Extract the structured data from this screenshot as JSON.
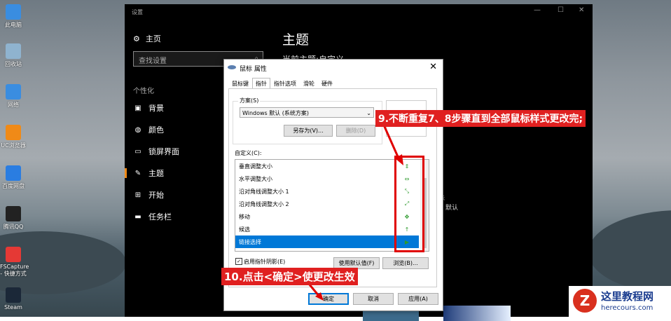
{
  "desktop": {
    "icons": [
      {
        "label": "此电脑",
        "color": "#3a8de0"
      },
      {
        "label": "回收站",
        "color": "#8fb3cf"
      },
      {
        "label": "网络",
        "color": "#3a8de0"
      },
      {
        "label": "UC浏览器",
        "color": "#f08a17"
      },
      {
        "label": "百度网盘",
        "color": "#2a7de1"
      },
      {
        "label": "腾讯QQ",
        "color": "#222222"
      },
      {
        "label": "FSCapture - 快捷方式",
        "color": "#e53935"
      },
      {
        "label": "Steam",
        "color": "#1b2838"
      }
    ]
  },
  "settings": {
    "window_title": "设置",
    "controls": {
      "minimize": "—",
      "maximize": "☐",
      "close": "✕"
    },
    "home": "主页",
    "search_placeholder": "查找设置",
    "group": "个性化",
    "nav": [
      {
        "label": "背景",
        "icon": "image-icon"
      },
      {
        "label": "颜色",
        "icon": "palette-icon"
      },
      {
        "label": "锁屏界面",
        "icon": "lockscreen-icon"
      },
      {
        "label": "主题",
        "icon": "theme-icon",
        "active": true
      },
      {
        "label": "开始",
        "icon": "start-icon"
      },
      {
        "label": "任务栏",
        "icon": "taskbar-icon"
      }
    ],
    "heading": "主题",
    "current_theme": "当前主题:自定义",
    "fragment_1": "标",
    "fragment_2": "默认"
  },
  "dialog": {
    "title": "鼠标 属性",
    "close": "✕",
    "tabs": [
      "鼠标键",
      "指针",
      "指针选项",
      "滑轮",
      "硬件"
    ],
    "selected_tab": "指针",
    "scheme_label": "方案(S)",
    "scheme_value": "Windows 默认 (系统方案)",
    "save_as": "另存为(V)...",
    "delete": "删除(D)",
    "customize_label": "自定义(C):",
    "items": [
      {
        "name": "垂直调整大小",
        "cursor": "⇕"
      },
      {
        "name": "水平调整大小",
        "cursor": "⇔"
      },
      {
        "name": "沿对角线调整大小 1",
        "cursor": "⤡"
      },
      {
        "name": "沿对角线调整大小 2",
        "cursor": "⤢"
      },
      {
        "name": "移动",
        "cursor": "✥"
      },
      {
        "name": "候选",
        "cursor": "↑"
      },
      {
        "name": "链接选择",
        "cursor": "▶",
        "selected": true
      }
    ],
    "shadow_label": "启用指针阴影(E)",
    "shadow_checked": true,
    "use_default": "使用默认值(F)",
    "browse": "浏览(B)...",
    "ok": "确定",
    "cancel": "取消",
    "apply": "应用(A)"
  },
  "annotations": {
    "step9": "9.不断重复7、8步骤直到全部鼠标样式更改完;",
    "step10": "10.点击<确定>使更改生效"
  },
  "watermark": {
    "title": "这里教程网",
    "url": "herecours.com",
    "badge": "Z"
  }
}
